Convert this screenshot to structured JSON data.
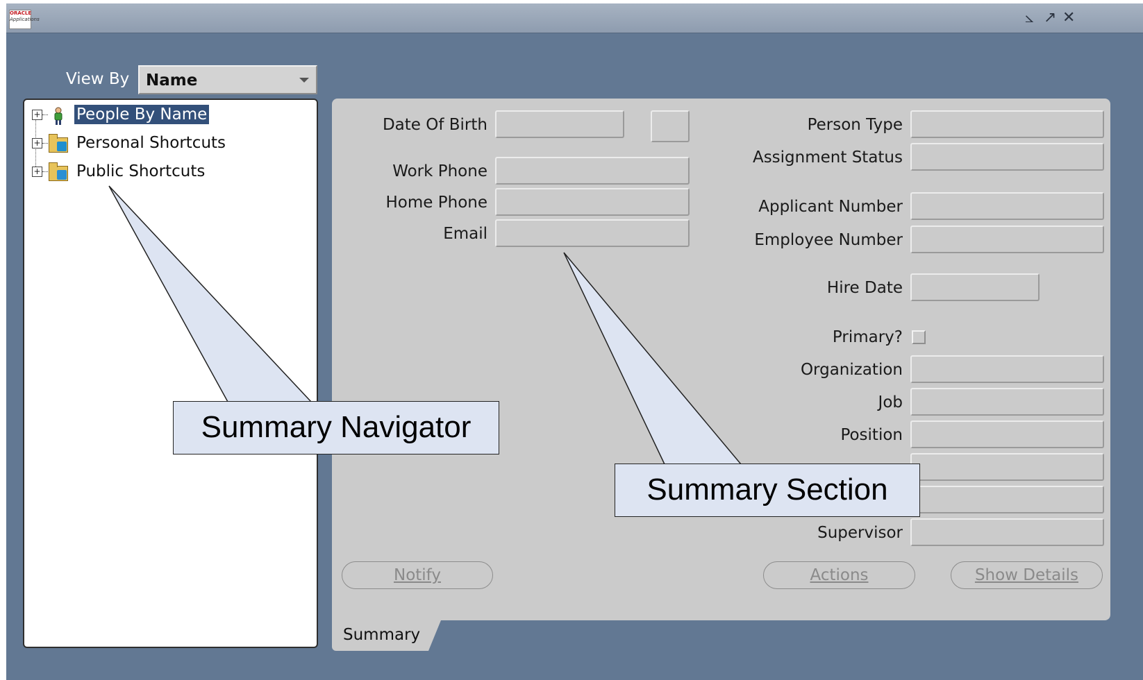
{
  "app": {
    "logo_line1": "ORACLE",
    "logo_line2": "Applications"
  },
  "window_controls": {
    "minimize_glyph": "⦣",
    "restore_glyph": "↗",
    "close_glyph": "✕"
  },
  "view_by": {
    "label": "View By",
    "value": "Name"
  },
  "navigator": {
    "items": [
      {
        "label": "People By Name",
        "icon": "person-icon",
        "selected": true
      },
      {
        "label": "Personal Shortcuts",
        "icon": "folder-person-icon",
        "selected": false
      },
      {
        "label": "Public Shortcuts",
        "icon": "folder-people-icon",
        "selected": false
      }
    ]
  },
  "summary": {
    "left_fields": {
      "date_of_birth": {
        "label": "Date Of Birth",
        "value": ""
      },
      "work_phone": {
        "label": "Work Phone",
        "value": ""
      },
      "home_phone": {
        "label": "Home Phone",
        "value": ""
      },
      "email": {
        "label": "Email",
        "value": ""
      }
    },
    "right_fields": {
      "person_type": {
        "label": "Person Type",
        "value": ""
      },
      "assignment_status": {
        "label": "Assignment Status",
        "value": ""
      },
      "applicant_number": {
        "label": "Applicant Number",
        "value": ""
      },
      "employee_number": {
        "label": "Employee Number",
        "value": ""
      },
      "hire_date": {
        "label": "Hire Date",
        "value": ""
      },
      "primary": {
        "label": "Primary?",
        "checked": false
      },
      "organization": {
        "label": "Organization",
        "value": ""
      },
      "job": {
        "label": "Job",
        "value": ""
      },
      "position": {
        "label": "Position",
        "value": ""
      },
      "supervisor": {
        "label": "Supervisor",
        "value": ""
      }
    },
    "buttons": {
      "notify": "Notify",
      "actions": "Actions",
      "show_details": "Show Details"
    },
    "tab_label": "Summary"
  },
  "callouts": {
    "navigator": "Summary Navigator",
    "section": "Summary Section"
  },
  "colors": {
    "window_bg": "#627893",
    "panel_bg": "#cbcbcb",
    "selection": "#33507a",
    "callout_fill": "#dde4f2"
  }
}
